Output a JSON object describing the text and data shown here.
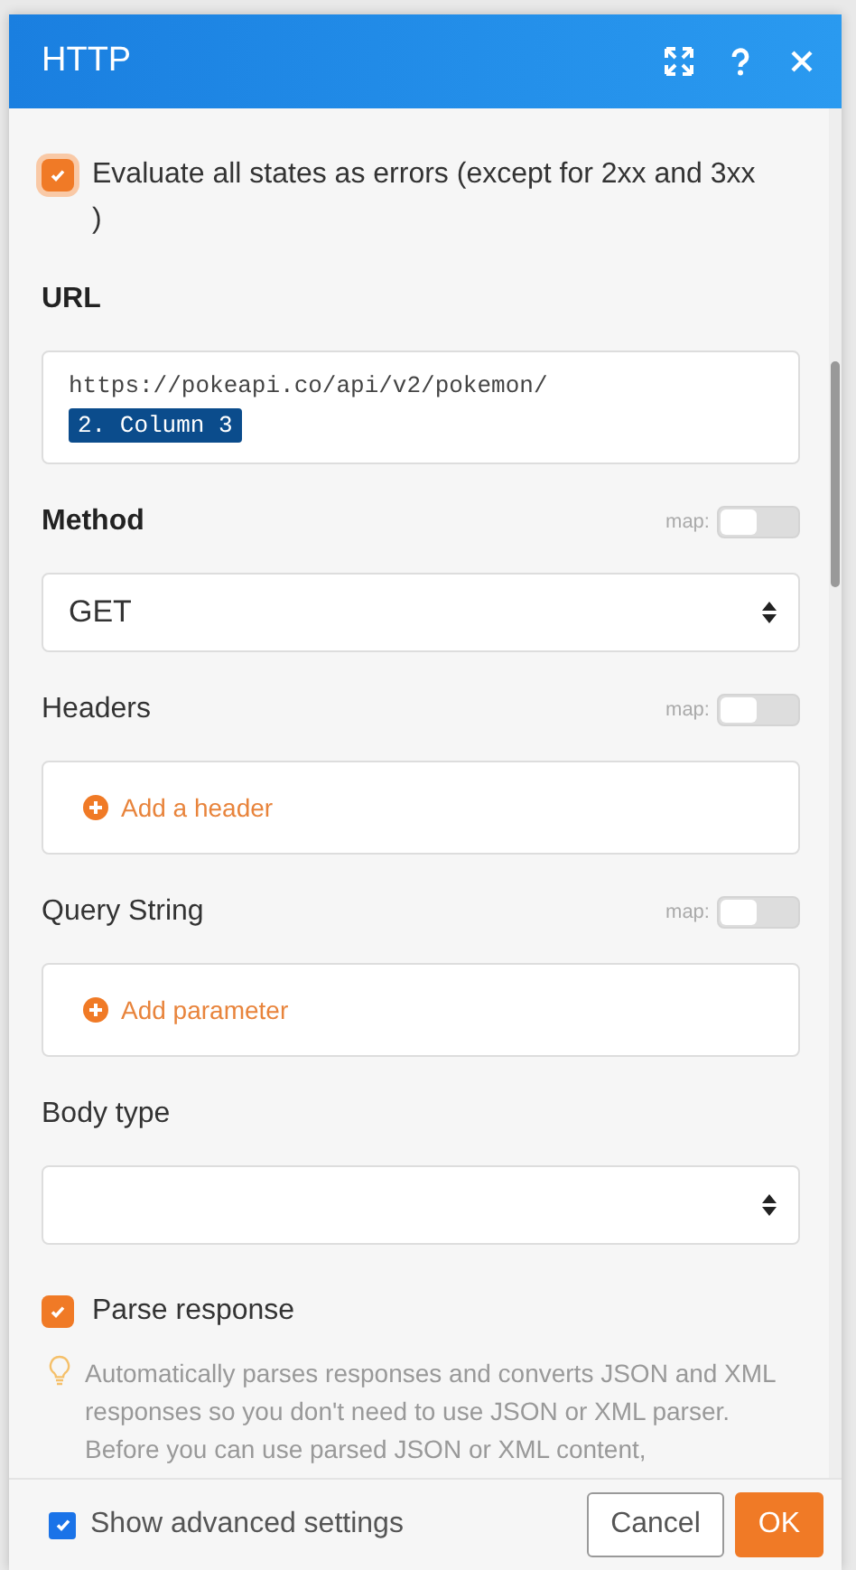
{
  "window": {
    "title": "HTTP"
  },
  "evaluate_errors": {
    "label": "Evaluate all states as errors (except for 2xx and 3xx )",
    "checked": true
  },
  "url": {
    "label": "URL",
    "text": "https://pokeapi.co/api/v2/pokemon/",
    "token": "2. Column 3"
  },
  "fields": [
    {
      "kind": "select",
      "label": "Method",
      "bold": true,
      "map_label": "map:",
      "map_on": false,
      "value": "GET"
    },
    {
      "kind": "add",
      "label": "Headers",
      "bold": false,
      "map_label": "map:",
      "map_on": false,
      "action": "Add a header"
    },
    {
      "kind": "add",
      "label": "Query String",
      "bold": false,
      "map_label": "map:",
      "map_on": false,
      "action": "Add parameter"
    },
    {
      "kind": "select",
      "label": "Body type",
      "bold": false
    }
  ],
  "parse_response": {
    "label": "Parse response",
    "checked": true,
    "help": "Automatically parses responses and converts JSON and XML responses so you don't need to use JSON or XML parser. Before you can use parsed JSON or XML content,"
  },
  "footer": {
    "advanced": {
      "label": "Show advanced settings",
      "checked": true
    },
    "buttons": [
      {
        "label": "Cancel",
        "kind": "secondary"
      },
      {
        "label": "OK",
        "kind": "primary"
      }
    ]
  }
}
